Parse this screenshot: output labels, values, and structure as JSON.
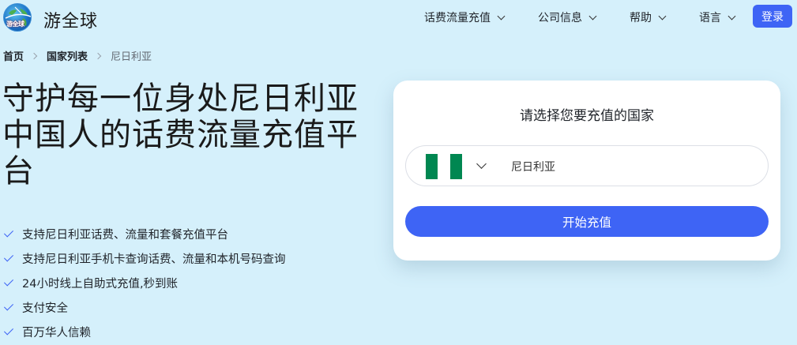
{
  "header": {
    "logo_text": "游全球",
    "brand": "游全球",
    "nav": [
      {
        "label": "话费流量充值",
        "icon": "chevron-down-icon"
      },
      {
        "label": "公司信息",
        "icon": "chevron-down-icon"
      },
      {
        "label": "帮助",
        "icon": "chevron-down-icon"
      },
      {
        "label": "语言",
        "icon": "chevron-down-icon"
      }
    ],
    "login_label": "登录"
  },
  "breadcrumb": {
    "home": "首页",
    "countries": "国家列表",
    "current": "尼日利亚"
  },
  "hero": {
    "title": "守护每一位身处尼日利亚中国人的话费流量充值平台",
    "features": [
      "支持尼日利亚话费、流量和套餐充值平台",
      "支持尼日利亚手机卡查询话费、流量和本机号码查询",
      "24小时线上自助式充值,秒到账",
      "支付安全",
      "百万华人信赖"
    ]
  },
  "card": {
    "title": "请选择您要充值的国家",
    "selected_country": "尼日利亚",
    "flag_colors": [
      "#008751",
      "#ffffff",
      "#008751"
    ],
    "start_label": "开始充值"
  },
  "colors": {
    "background": "#d5f0fb",
    "accent": "#3e64f5"
  }
}
